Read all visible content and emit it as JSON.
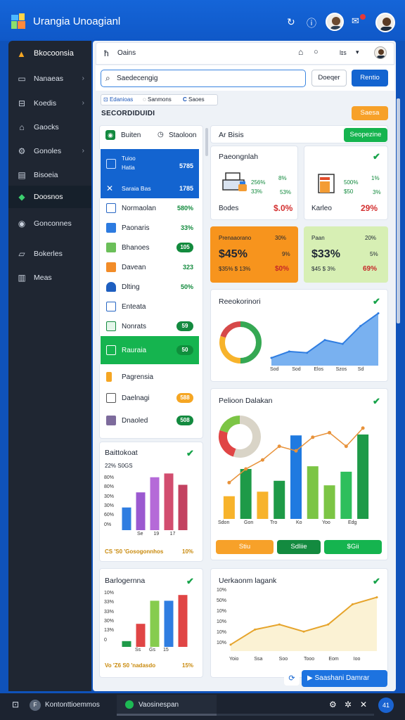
{
  "app": {
    "title": "Urangia Unoagianl"
  },
  "header": {
    "nav_label": "Oains",
    "zoom": "lɪs"
  },
  "search": {
    "placeholder": "Saedecengig",
    "btn1": "Doeqer",
    "btn2": "Rentio"
  },
  "chips": [
    "Edanioas",
    "Sanmons",
    "Saoes"
  ],
  "section": {
    "title": "SECORDIDUIDI",
    "filter_btn": "Saesa",
    "tab1": "Buiten",
    "tab2": "Staoloon"
  },
  "sidebar": {
    "logo": "Bkocoonsia",
    "items": [
      {
        "label": "Nanaeas",
        "chevron": true
      },
      {
        "label": "Koedis",
        "chevron": true
      },
      {
        "label": "Gaocks",
        "chevron": false
      },
      {
        "label": "Gonoles",
        "chevron": true
      },
      {
        "label": "Bisoeia",
        "chevron": false
      },
      {
        "label": "Doosnos",
        "chevron": false,
        "active": true
      },
      {
        "label": "Gonconnes",
        "chevron": false
      },
      {
        "label": "Bokerles",
        "chevron": false
      },
      {
        "label": "Meas",
        "chevron": false
      }
    ]
  },
  "list": [
    {
      "label": "Tuioo",
      "sub": "Hatia",
      "value": "5785",
      "style": "blue"
    },
    {
      "label": "Saraia Bas",
      "value": "1785",
      "style": "blue"
    },
    {
      "label": "Normaolan",
      "value": "580%",
      "style": "plain"
    },
    {
      "label": "Paonaris",
      "value": "33%",
      "style": "plain"
    },
    {
      "label": "Bhanoes",
      "value": "105",
      "style": "pill"
    },
    {
      "label": "Davean",
      "value": "323",
      "style": "plain"
    },
    {
      "label": "Dlting",
      "value": "50%",
      "style": "plain"
    },
    {
      "label": "Enteata",
      "value": "",
      "style": "plain"
    },
    {
      "label": "Nonrats",
      "value": "59",
      "style": "pill"
    },
    {
      "label": "Rauraia",
      "value": "50",
      "style": "green"
    },
    {
      "label": "Pagrensia",
      "value": "",
      "style": "plain"
    },
    {
      "label": "Daelnagi",
      "value": "588",
      "style": "orangepill"
    },
    {
      "label": "Dnaoled",
      "value": "508",
      "style": "pill"
    }
  ],
  "stats_header": {
    "title": "Ar Bisis",
    "btn": "Seopezine"
  },
  "stat_cards": [
    {
      "title": "Paeongnlah",
      "v1": "256%",
      "v2": "33%",
      "v3": "8%",
      "v4": "53%",
      "foot": "Bodes",
      "foot_val": "$.0%"
    },
    {
      "title": "",
      "v1": "500%",
      "v2": "$50",
      "v3": "1%",
      "v4": "3%",
      "foot": "Karleo",
      "foot_val": "29%"
    }
  ],
  "metric_cards": [
    {
      "title": "Prenaaorano",
      "top": "30%",
      "big": "$45%",
      "mid": "9%",
      "foot": "$35% $ 13%",
      "foot_val": "$0%"
    },
    {
      "title": "Paan",
      "top": "20%",
      "big": "$33%",
      "mid": "5%",
      "foot": "$45 $ 3%",
      "foot_val": "69%"
    }
  ],
  "chart_cards": [
    {
      "title": "Reeokorinori",
      "xticks": [
        "Sod",
        "Sod",
        "Elos",
        "Szos",
        "Sd"
      ]
    },
    {
      "title": "Pelioon Dalakan",
      "xticks": [
        "Sdon",
        "Gon",
        "Tro",
        "Ko",
        "Yoo",
        "Edg"
      ],
      "buttons": [
        "Stiu",
        "Sdliie",
        "$Gii"
      ]
    },
    {
      "title": "Uerkaonm lagank",
      "xticks": [
        "Yoio",
        "Ssa",
        "Soo",
        "Tooo",
        "Eom",
        "Ioo"
      ],
      "yticks": [
        "10%",
        "50%",
        "10%",
        "10%",
        "10%",
        "10%"
      ]
    }
  ],
  "mini_charts": [
    {
      "title": "Baittokoat",
      "sub": "22% S0GS",
      "yticks": [
        "80%",
        "80%",
        "30%",
        "30%",
        "60%",
        "0%"
      ],
      "xticks": [
        "Se",
        "19",
        "17"
      ],
      "foot": "CS 'S0 'Gosogonnhos",
      "foot_val": "10%"
    },
    {
      "title": "Barlogernna",
      "yticks": [
        "10%",
        "33%",
        "33%",
        "30%",
        "13%",
        "0"
      ],
      "xticks": [
        "Ss",
        "Gs",
        "15"
      ],
      "foot": "Vo 'Z6 S0 'nadasdo",
      "foot_val": "15%"
    }
  ],
  "footer": {
    "action": "Saashani Damrar",
    "task1": "Kontonttioemmos",
    "task2": "Vaosinespan",
    "tray_badge": "41"
  },
  "chart_data": [
    {
      "type": "pie",
      "values": [
        0.5,
        0.3,
        0.2
      ],
      "colors": [
        "#35a853",
        "#f7b32b",
        "#d64949"
      ]
    },
    {
      "type": "area",
      "values": [
        5,
        10,
        9,
        19,
        16,
        30,
        40
      ],
      "ylim": [
        0,
        42
      ],
      "color": "#4a90e2"
    },
    {
      "type": "bar",
      "xticks": [
        "Sdon",
        "Gon",
        "Tro",
        "Ko",
        "Yoo",
        "Edg"
      ],
      "values": [
        25,
        55,
        30,
        42,
        92,
        58,
        37,
        52,
        93
      ],
      "colors": [
        "#f7b32b",
        "#1e9a48",
        "#f7b32b",
        "#1e9a48",
        "#1f7ae0",
        "#7cc545",
        "#7cc545",
        "#2ebf5c",
        "#1e9a48"
      ],
      "line": [
        40,
        55,
        65,
        80,
        75,
        90,
        95,
        80,
        100
      ],
      "ylim": [
        0,
        110
      ]
    },
    {
      "type": "bar",
      "values": [
        30,
        50,
        70,
        75,
        60
      ],
      "colors": [
        "#2f7de1",
        "#9b59d0",
        "#b56ad8",
        "#d24d6f",
        "#c34261"
      ],
      "ylim": [
        0,
        80
      ]
    },
    {
      "type": "bar",
      "values": [
        10,
        40,
        80,
        80,
        90
      ],
      "colors": [
        "#1e9a48",
        "#e04545",
        "#86cc4e",
        "#2f7de1",
        "#e04545"
      ],
      "ylim": [
        0,
        100
      ]
    },
    {
      "type": "area",
      "values": [
        5,
        20,
        25,
        18,
        25,
        45,
        52
      ],
      "ylim": [
        0,
        60
      ],
      "color": "#e6a42b"
    }
  ]
}
